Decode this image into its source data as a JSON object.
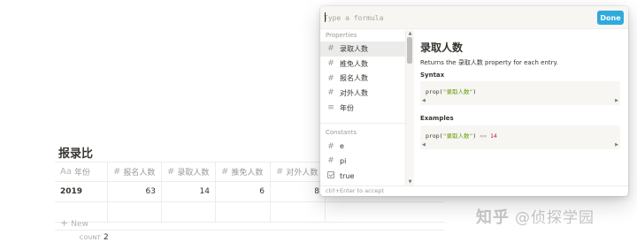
{
  "database": {
    "title": "报录比",
    "columns": [
      {
        "icon": "Aa",
        "label": "年份"
      },
      {
        "icon": "#",
        "label": "报名人数"
      },
      {
        "icon": "#",
        "label": "录取人数"
      },
      {
        "icon": "#",
        "label": "推免人数"
      },
      {
        "icon": "#",
        "label": "对外人数"
      }
    ],
    "rows": [
      {
        "year": "2019",
        "applicants": "63",
        "admitted": "14",
        "recommended": "6",
        "external": "8"
      }
    ],
    "new_label": "New",
    "count_label": "COUNT",
    "count_value": "2"
  },
  "formula": {
    "placeholder": "Type a formula",
    "done_label": "Done",
    "sections": {
      "properties_title": "Properties",
      "constants_title": "Constants"
    },
    "properties": [
      {
        "icon": "hash-icon",
        "label": "录取人数",
        "selected": true
      },
      {
        "icon": "hash-icon",
        "label": "推免人数"
      },
      {
        "icon": "hash-icon",
        "label": "报名人数"
      },
      {
        "icon": "hash-icon",
        "label": "对外人数"
      },
      {
        "icon": "text-icon",
        "label": "年份"
      }
    ],
    "constants": [
      {
        "icon": "hash-icon",
        "label": "e"
      },
      {
        "icon": "hash-icon",
        "label": "pi"
      },
      {
        "icon": "checkbox-icon",
        "label": "true"
      }
    ],
    "detail": {
      "title": "录取人数",
      "description": "Returns the 录取人数 property for each entry.",
      "syntax_label": "Syntax",
      "syntax_fn": "prop(",
      "syntax_arg": "\"录取人数\"",
      "syntax_close": ")",
      "examples_label": "Examples",
      "example_fn": "prop(",
      "example_arg": "\"录取人数\"",
      "example_close": ")",
      "example_op": "==",
      "example_result": "14"
    },
    "footer_hint": "ctrl+Enter to accept"
  },
  "watermark": {
    "brand": "知乎",
    "handle": "@侦探学园"
  },
  "colors": {
    "accent": "#2eaadc",
    "selected_row": "#ebebea",
    "panel_bg": "#f7f6f3"
  }
}
